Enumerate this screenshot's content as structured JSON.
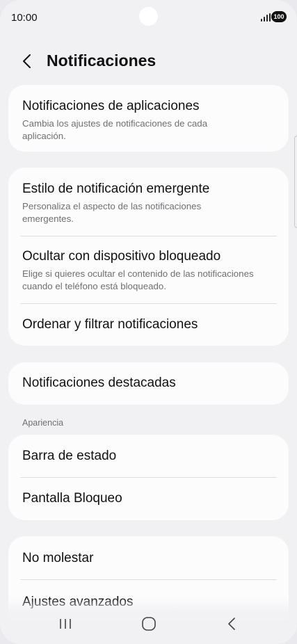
{
  "status_bar": {
    "time": "10:00",
    "battery": "100"
  },
  "header": {
    "title": "Notificaciones"
  },
  "cards": {
    "app_notifications": {
      "title": "Notificaciones de aplicaciones",
      "subtitle": "Cambia los ajustes de notificaciones de cada aplicación."
    },
    "popup_style": {
      "title": "Estilo de notificación emergente",
      "subtitle": "Personaliza el aspecto de las notificaciones emergentes."
    },
    "hide_locked": {
      "title": "Ocultar con dispositivo bloqueado",
      "subtitle": "Elige si quieres ocultar el contenido de las notificaciones cuando el teléfono está bloqueado."
    },
    "sort_filter": {
      "title": "Ordenar y filtrar notificaciones"
    },
    "featured": {
      "title": "Notificaciones destacadas"
    },
    "appearance_label": "Apariencia",
    "status_bar_item": {
      "title": "Barra de estado"
    },
    "lock_screen": {
      "title": "Pantalla Bloqueo"
    },
    "do_not_disturb": {
      "title": "No molestar"
    },
    "advanced": {
      "title": "Ajustes avanzados"
    }
  },
  "icons": {
    "back": "chevron-left-icon",
    "nav_recents": "recents-icon",
    "nav_home": "home-icon",
    "nav_back": "back-icon"
  },
  "colors": {
    "background": "#f1f1f4",
    "card": "#fcfcfd",
    "subtitle": "#6f6f75"
  }
}
